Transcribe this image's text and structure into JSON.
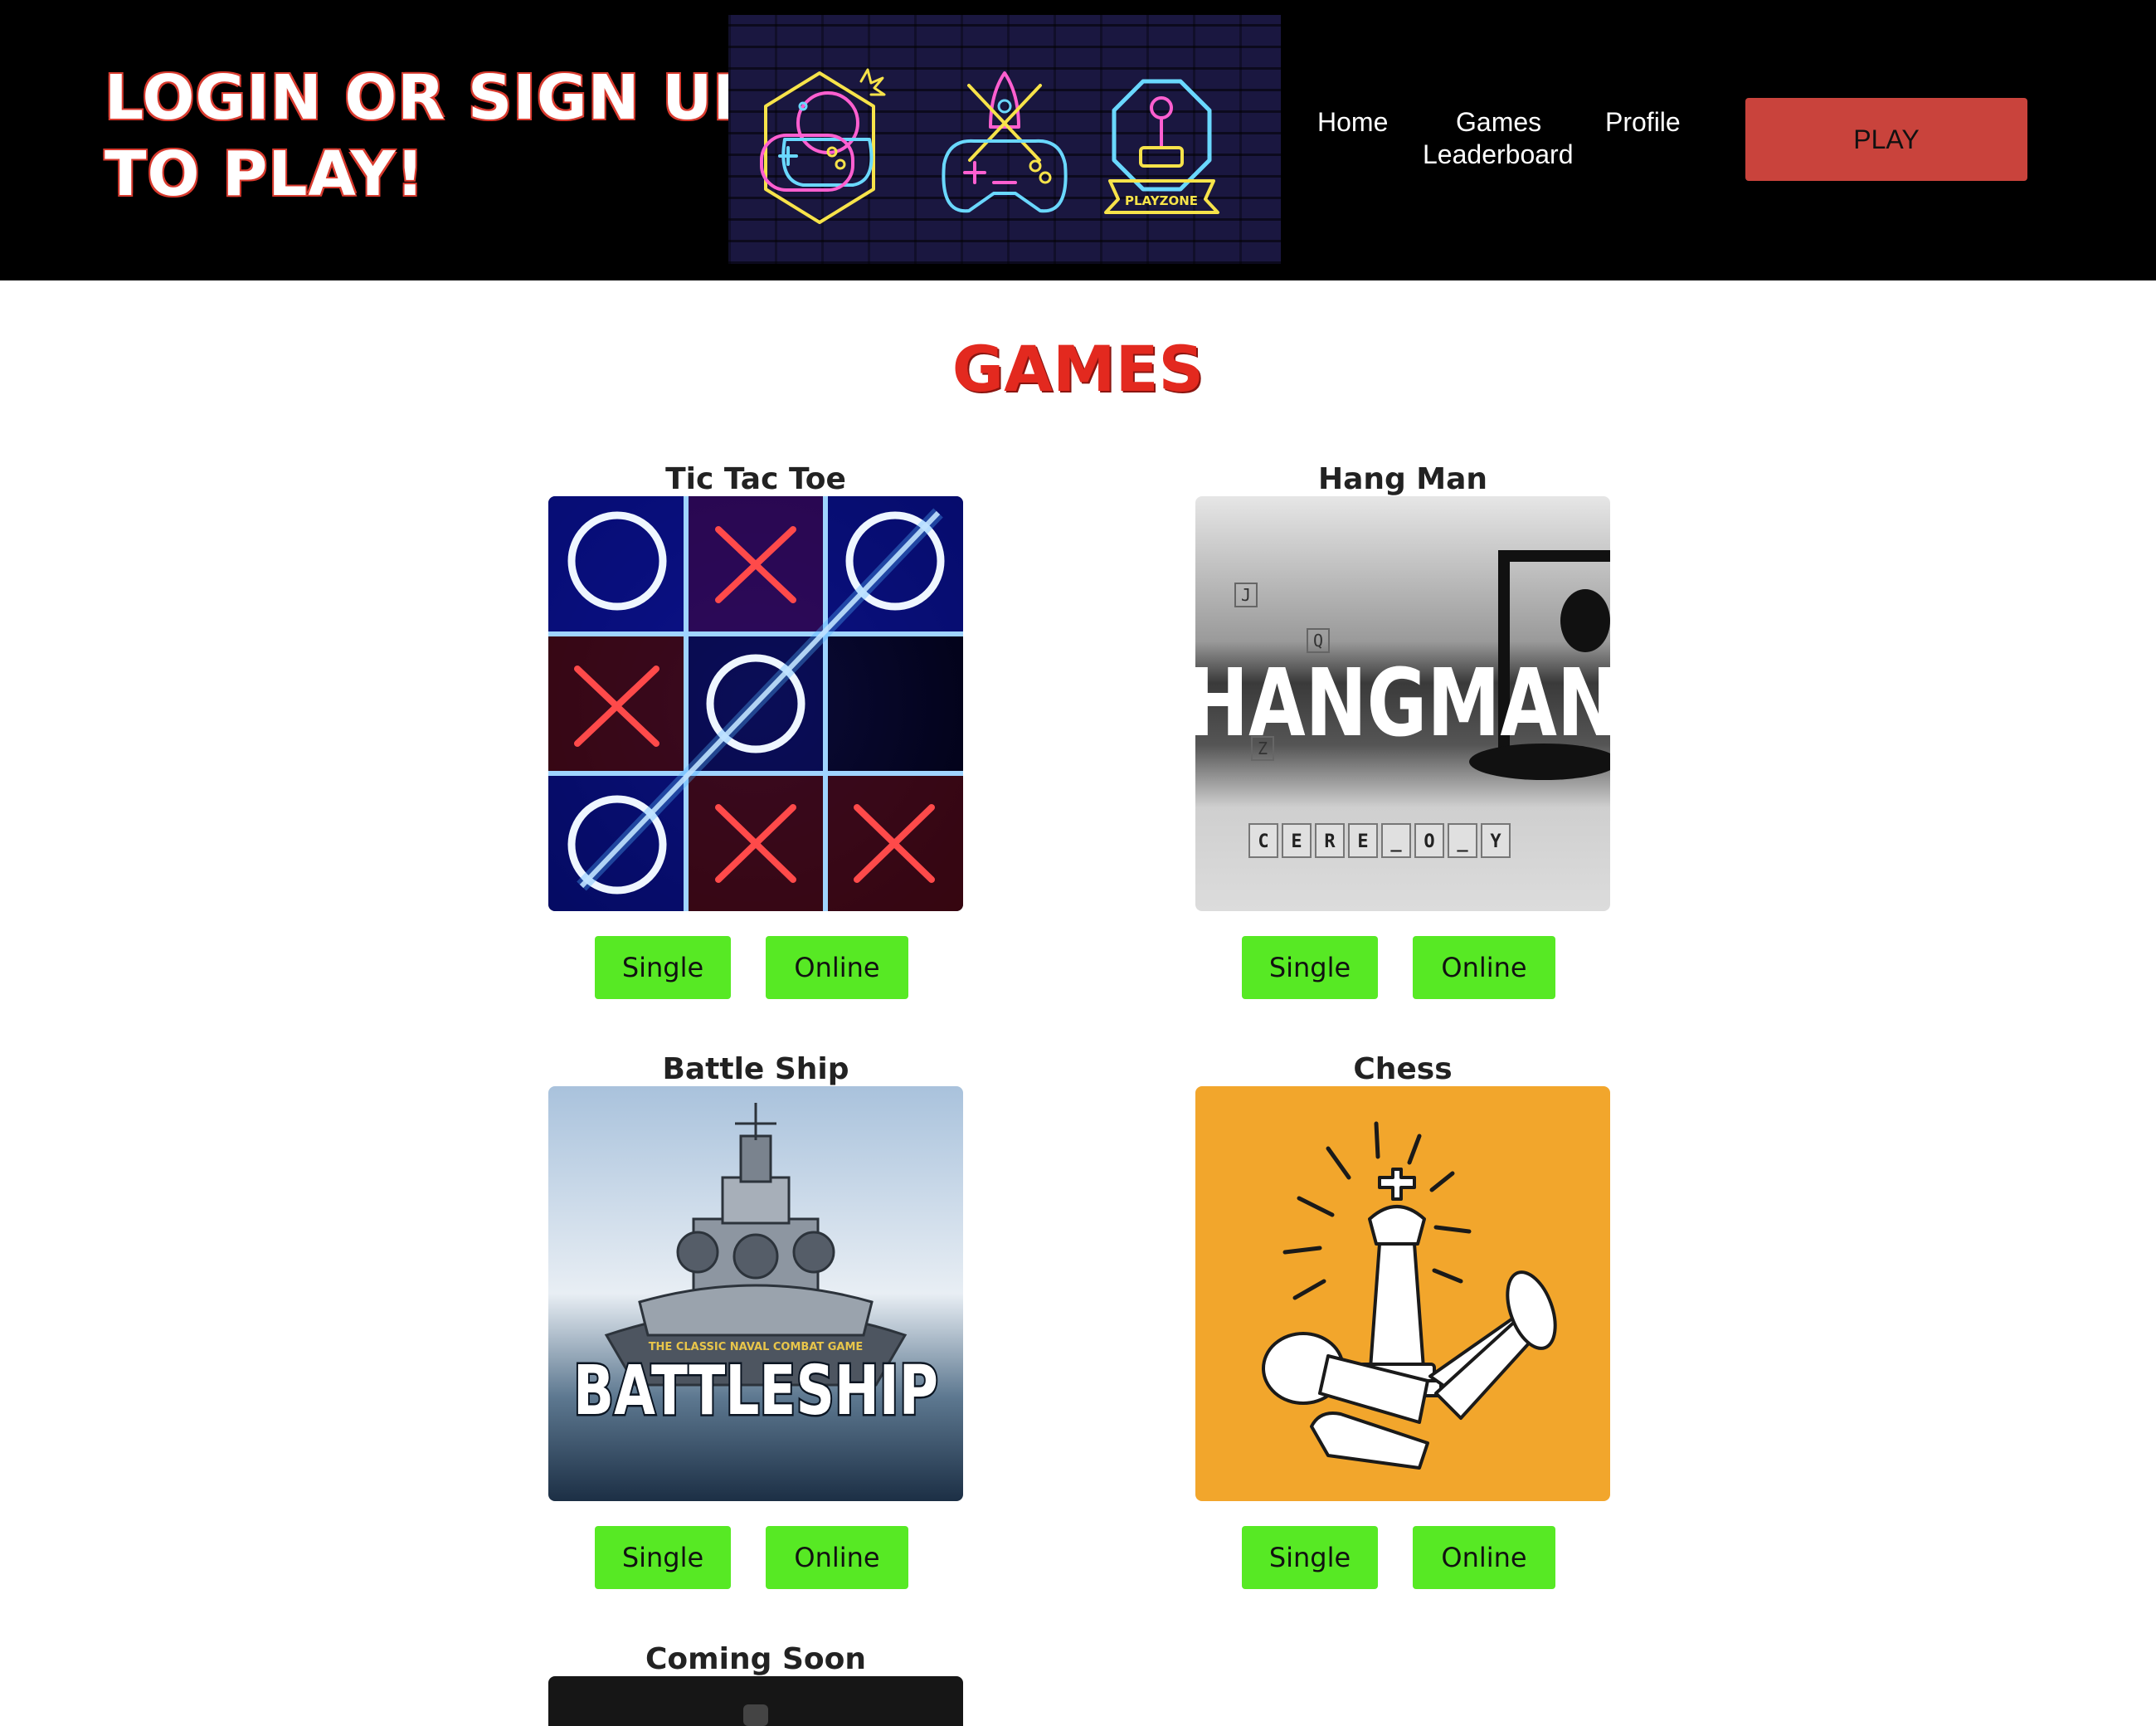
{
  "header": {
    "login_title_line1": "LOGIN OR SIGN UP",
    "login_title_line2": "TO PLAY!",
    "banner_badge": "PLAYZONE",
    "nav": {
      "home": "Home",
      "games": "Games",
      "profile": "Profile",
      "leaderboard": "Leaderboard"
    },
    "play_label": "PLAY"
  },
  "main": {
    "heading": "GAMES",
    "games": [
      {
        "title": "Tic Tac Toe",
        "single": "Single",
        "online": "Online"
      },
      {
        "title": "Hang Man",
        "single": "Single",
        "online": "Online",
        "image_text": "HANGMAN",
        "tiles": [
          "C",
          "E",
          "R",
          "E",
          "_",
          "O",
          "_",
          "Y"
        ],
        "floating_letters": [
          "J",
          "Q",
          "Z"
        ]
      },
      {
        "title": "Battle Ship",
        "single": "Single",
        "online": "Online",
        "image_text": "BATTLESHIP",
        "image_subtext": "THE CLASSIC NAVAL COMBAT GAME"
      },
      {
        "title": "Chess",
        "single": "Single",
        "online": "Online"
      },
      {
        "title": "Coming Soon"
      }
    ]
  },
  "colors": {
    "header_bg": "#000000",
    "heading_red": "#e3291f",
    "play_button": "#c9433c",
    "game_button": "#57e924",
    "chess_bg": "#f2a62c"
  },
  "icons": [
    "gamepad-bomb-icon",
    "rocket-gamepad-icon",
    "joystick-playzone-icon",
    "tic-tac-toe-icon",
    "hangman-icon",
    "battleship-icon",
    "chess-icon"
  ]
}
